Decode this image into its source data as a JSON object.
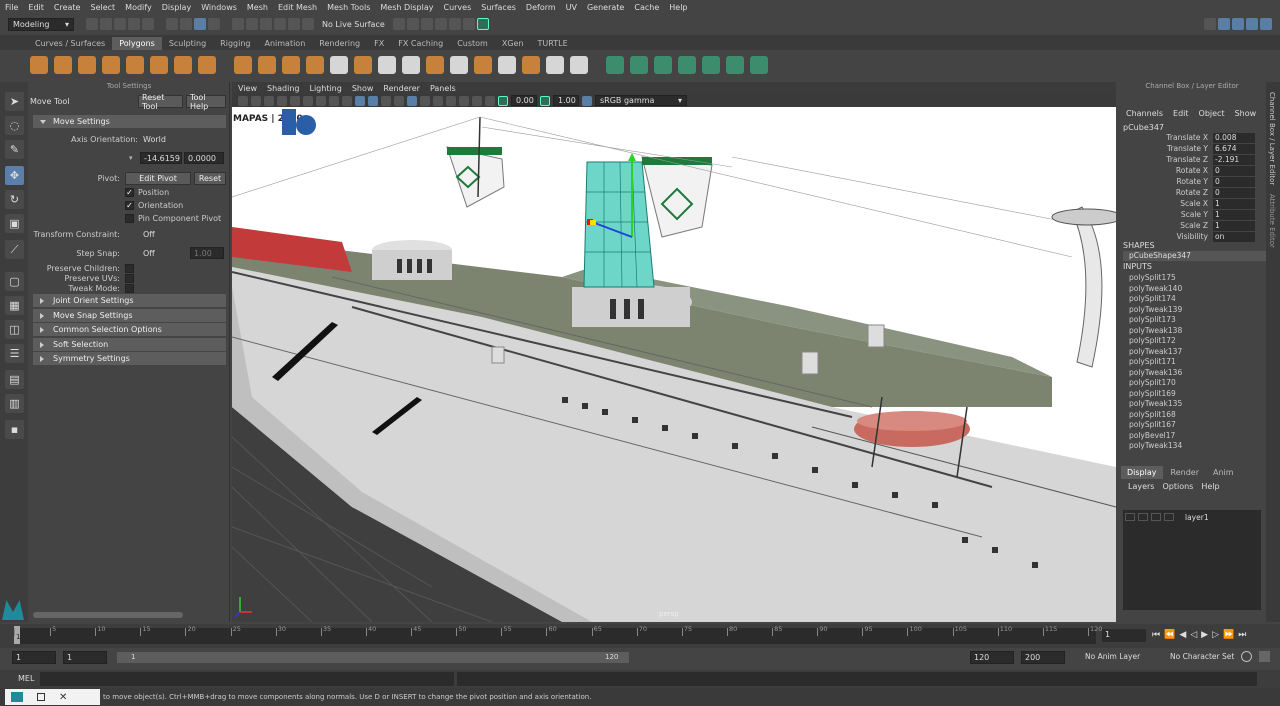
{
  "menubar": [
    "File",
    "Edit",
    "Create",
    "Select",
    "Modify",
    "Display",
    "Windows",
    "Mesh",
    "Edit Mesh",
    "Mesh Tools",
    "Mesh Display",
    "Curves",
    "Surfaces",
    "Deform",
    "UV",
    "Generate",
    "Cache",
    "Help"
  ],
  "statusline": {
    "mode": "Modeling",
    "live_surface": "No Live Surface"
  },
  "shelf_tabs": [
    "Curves / Surfaces",
    "Polygons",
    "Sculpting",
    "Rigging",
    "Animation",
    "Rendering",
    "FX",
    "FX Caching",
    "Custom",
    "XGen",
    "TURTLE"
  ],
  "shelf_active": "Polygons",
  "tool_settings": {
    "panel_title": "Tool Settings",
    "tool_name": "Move Tool",
    "reset_tool": "Reset Tool",
    "tool_help": "Tool Help",
    "move_settings": "Move Settings",
    "axis_orientation_label": "Axis Orientation:",
    "axis_orientation_value": "World",
    "field1": "-14.6159",
    "field2": "0.0000",
    "pivot_label": "Pivot:",
    "edit_pivot": "Edit Pivot",
    "reset": "Reset",
    "position": "Position",
    "orientation": "Orientation",
    "pin_component_pivot": "Pin Component Pivot",
    "transform_constraint_label": "Transform Constraint:",
    "transform_constraint_value": "Off",
    "step_snap_label": "Step Snap:",
    "step_snap_value": "Off",
    "step_snap_num": "1.00",
    "preserve_children": "Preserve Children:",
    "preserve_uvs": "Preserve UVs:",
    "tweak_mode": "Tweak Mode:",
    "sections": [
      "Joint Orient Settings",
      "Move Snap Settings",
      "Common Selection Options",
      "Soft Selection",
      "Symmetry Settings"
    ]
  },
  "viewport": {
    "menus": [
      "View",
      "Shading",
      "Lighting",
      "Show",
      "Renderer",
      "Panels"
    ],
    "exposure": "0.00",
    "gamma": "1.00",
    "color_space": "sRGB gamma",
    "camera": "persp",
    "watermark": "MAPAS | 2020"
  },
  "channel_box": {
    "title": "Channel Box / Layer Editor",
    "menus": [
      "Channels",
      "Edit",
      "Object",
      "Show"
    ],
    "object": "pCube347",
    "attributes": [
      {
        "name": "Translate X",
        "value": "0.008"
      },
      {
        "name": "Translate Y",
        "value": "6.674"
      },
      {
        "name": "Translate Z",
        "value": "-2.191"
      },
      {
        "name": "Rotate X",
        "value": "0"
      },
      {
        "name": "Rotate Y",
        "value": "0"
      },
      {
        "name": "Rotate Z",
        "value": "0"
      },
      {
        "name": "Scale X",
        "value": "1"
      },
      {
        "name": "Scale Y",
        "value": "1"
      },
      {
        "name": "Scale Z",
        "value": "1"
      },
      {
        "name": "Visibility",
        "value": "on"
      }
    ],
    "shapes_label": "SHAPES",
    "shape": "pCubeShape347",
    "inputs_label": "INPUTS",
    "inputs": [
      "polySplit175",
      "polyTweak140",
      "polySplit174",
      "polyTweak139",
      "polySplit173",
      "polyTweak138",
      "polySplit172",
      "polyTweak137",
      "polySplit171",
      "polyTweak136",
      "polySplit170",
      "polySplit169",
      "polyTweak135",
      "polySplit168",
      "polySplit167",
      "polyBevel17",
      "polyTweak134"
    ]
  },
  "layer_editor": {
    "tabs": [
      "Display",
      "Render",
      "Anim"
    ],
    "menus": [
      "Layers",
      "Options",
      "Help"
    ],
    "layer": "layer1"
  },
  "attribute_tabs": [
    "Channel Box / Layer Editor",
    "Attribute Editor"
  ],
  "timeline": {
    "ticks": [
      "1",
      "5",
      "10",
      "15",
      "20",
      "25",
      "30",
      "35",
      "40",
      "45",
      "50",
      "55",
      "60",
      "65",
      "70",
      "75",
      "80",
      "85",
      "90",
      "95",
      "100",
      "105",
      "110",
      "115",
      "120"
    ],
    "current_frame": "1"
  },
  "range": {
    "start": "1",
    "start2": "1",
    "slider_start": "1",
    "slider_end": "120",
    "end": "120",
    "end2": "200",
    "anim_layer": "No Anim Layer",
    "char_set": "No Character Set"
  },
  "cmdline": {
    "label": "MEL"
  },
  "help_text": "to move object(s). Ctrl+MMB+drag to move components along normals. Use D or INSERT to change the pivot position and axis orientation."
}
